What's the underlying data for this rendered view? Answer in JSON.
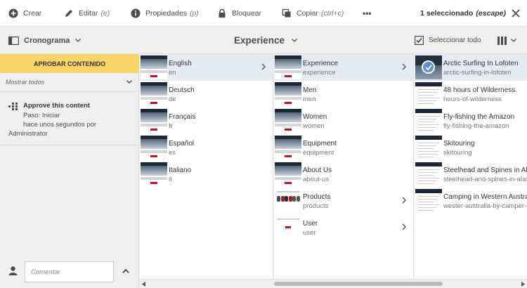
{
  "actionbar": {
    "create": {
      "label": "Crear",
      "icon": "add-circle-icon"
    },
    "edit": {
      "label": "Editar",
      "shortcut": "(e)",
      "icon": "pencil-icon"
    },
    "properties": {
      "label": "Propiedades",
      "shortcut": "(p)",
      "icon": "info-icon"
    },
    "lock": {
      "label": "Bloquear",
      "icon": "lock-icon"
    },
    "copy": {
      "label": "Copiar",
      "shortcut": "(ctrl+c)",
      "icon": "copy-icon"
    },
    "more": {
      "label": "•••",
      "icon": "more-icon"
    },
    "selection": {
      "count_label": "1 seleccionado",
      "escape_label": "(escape)"
    },
    "close_icon": "close-icon"
  },
  "header": {
    "rail_label": "Cronograma",
    "title": "Experience",
    "select_all": "Seleccionar todo",
    "view_icon": "column-view-icon"
  },
  "rail": {
    "approve_button": "APROBAR CONTENIDO",
    "filter": "Mostrar todos",
    "timeline_item": {
      "title": "Approve this content",
      "step": "Paso: Iniciar",
      "time": "hace unos segundos por",
      "user": "Administrator"
    },
    "comment_placeholder": "Comentar"
  },
  "columns": [
    {
      "items": [
        {
          "title": "English",
          "name": "en",
          "selected": true,
          "has_children": true,
          "thumb": "page"
        },
        {
          "title": "Deutsch",
          "name": "de",
          "selected": false,
          "has_children": false,
          "thumb": "page"
        },
        {
          "title": "Français",
          "name": "fr",
          "selected": false,
          "has_children": false,
          "thumb": "page"
        },
        {
          "title": "Español",
          "name": "es",
          "selected": false,
          "has_children": false,
          "thumb": "page"
        },
        {
          "title": "Italiano",
          "name": "it",
          "selected": false,
          "has_children": false,
          "thumb": "page"
        }
      ]
    },
    {
      "items": [
        {
          "title": "Experience",
          "name": "experience",
          "selected": true,
          "has_children": true,
          "thumb": "page"
        },
        {
          "title": "Men",
          "name": "men",
          "selected": false,
          "has_children": false,
          "thumb": "page"
        },
        {
          "title": "Women",
          "name": "women",
          "selected": false,
          "has_children": false,
          "thumb": "page"
        },
        {
          "title": "Equipment",
          "name": "equipment",
          "selected": false,
          "has_children": false,
          "thumb": "page"
        },
        {
          "title": "About Us",
          "name": "about-us",
          "selected": false,
          "has_children": false,
          "thumb": "page"
        },
        {
          "title": "Products",
          "name": "products",
          "selected": false,
          "has_children": true,
          "thumb": "products"
        },
        {
          "title": "User",
          "name": "user",
          "selected": false,
          "has_children": true,
          "thumb": "user"
        }
      ]
    },
    {
      "items": [
        {
          "title": "Arctic Surfing In Lofoten",
          "name": "arctic-surfing-in-lofoten",
          "selected": true,
          "has_children": false,
          "thumb": "arctic"
        },
        {
          "title": "48 hours of Wilderness",
          "name": "hours-of-wilderness",
          "selected": false,
          "has_children": false,
          "thumb": "article"
        },
        {
          "title": "Fly-fishing the Amazon",
          "name": "fly-fishing-the-amazon",
          "selected": false,
          "has_children": false,
          "thumb": "article"
        },
        {
          "title": "Skitouring",
          "name": "skitouring",
          "selected": false,
          "has_children": false,
          "thumb": "article"
        },
        {
          "title": "Steelhead and Spines in Alaska",
          "name": "steelhead-and-spines-in-alaska",
          "selected": false,
          "has_children": false,
          "thumb": "article"
        },
        {
          "title": "Camping in Western Australia",
          "name": "wester-australia-by-camper-van",
          "selected": false,
          "has_children": false,
          "thumb": "article"
        }
      ]
    }
  ],
  "colors": {
    "accent_yellow": "#f9d466",
    "selected_row": "#e5ebf3",
    "check_blue": "#5a8fd0"
  }
}
